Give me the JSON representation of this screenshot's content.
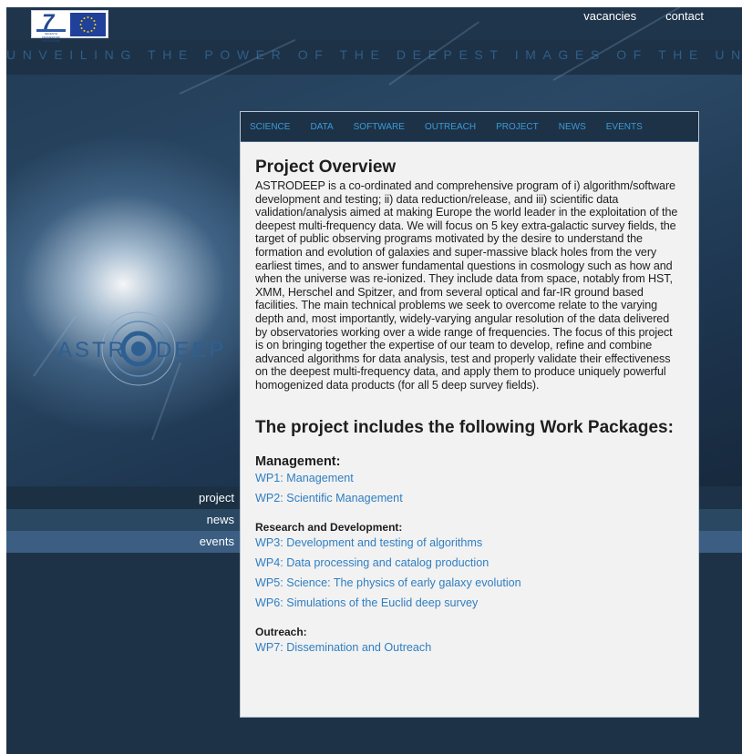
{
  "header": {
    "links": [
      "vacancies",
      "contact"
    ],
    "logo_fp7_caption": "SEVENTH FRAMEWORK PROGRAMME",
    "tagline": "UNVEILING THE POWER OF THE DEEPEST IMAGES OF THE UNIVERSE"
  },
  "hero": {
    "logo_text_left": "ASTR",
    "logo_text_right": "DEEP"
  },
  "topnav": [
    "SCIENCE",
    "DATA",
    "SOFTWARE",
    "OUTREACH",
    "PROJECT",
    "NEWS",
    "EVENTS"
  ],
  "leftnav": [
    "project",
    "news",
    "events"
  ],
  "content": {
    "title": "Project Overview",
    "intro": "ASTRODEEP is a co-ordinated and comprehensive program of i) algorithm/software development and testing; ii) data reduction/release, and iii) scientific data validation/analysis aimed at making Europe the world leader in the exploitation of the deepest multi-frequency data. We will focus on 5 key extra-galactic survey fields, the target of public observing programs motivated by the desire to understand the formation and evolution of galaxies and super-massive black holes from the very earliest times, and to answer fundamental questions in cosmology such as how and when the universe was re-ionized. They include data from space, notably from HST, XMM, Herschel and Spitzer, and from several optical and far-IR ground based facilities. The main technical problems we seek to overcome relate to the varying depth and, most importantly, widely-varying angular resolution of the data delivered by observatories working over a wide range of frequencies. The focus of this project is on bringing together the expertise of our team to develop, refine and combine advanced algorithms for data analysis, test and properly validate their effectiveness on the deepest multi-frequency data, and apply them to produce uniquely powerful homogenized data products (for all 5 deep survey fields).",
    "wp_heading": "The project includes the following Work Packages:",
    "sections": [
      {
        "heading": "Management:",
        "items": [
          "WP1: Management",
          "WP2: Scientific Management"
        ]
      },
      {
        "heading": "Research and Development:",
        "items": [
          "WP3: Development and testing of algorithms",
          "WP4: Data processing and catalog production",
          "WP5: Science: The physics of early galaxy evolution",
          "WP6: Simulations of the Euclid deep survey"
        ]
      },
      {
        "heading": "Outreach:",
        "items": [
          "WP7: Dissemination and Outreach"
        ]
      }
    ]
  },
  "colors": {
    "background": "#1d3247",
    "panel": "#f2f2f2",
    "link": "#2f7ec2",
    "nav_link": "#3b9ad6",
    "tagline": "#2e5e8a"
  }
}
